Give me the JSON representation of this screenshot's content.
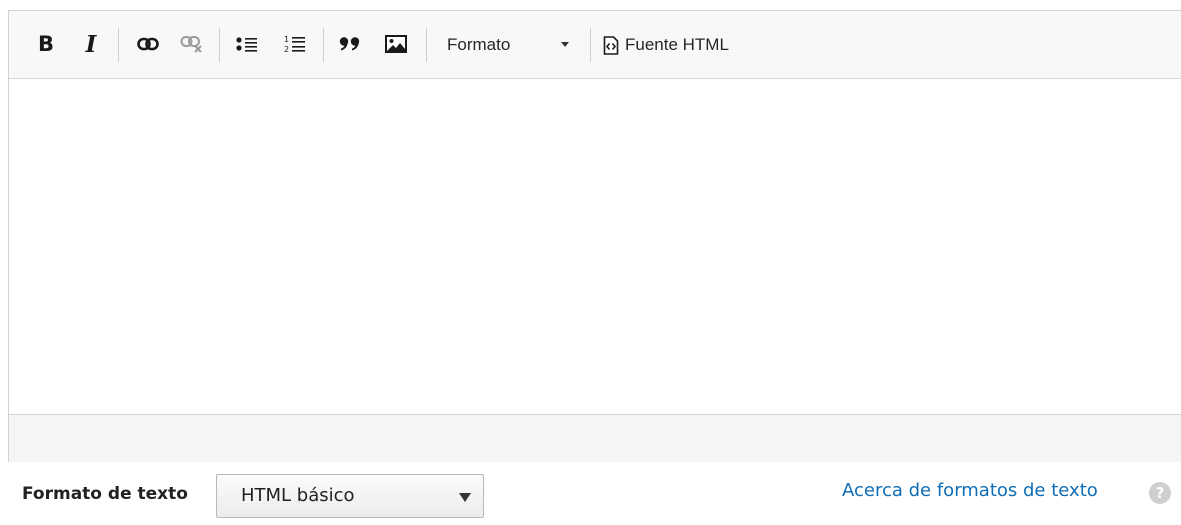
{
  "toolbar": {
    "bold_label": "B",
    "italic_label": "I",
    "link_icon": "link-icon",
    "unlink_icon": "unlink-icon",
    "bulleted_list_icon": "bulleted-list-icon",
    "numbered_list_icon": "numbered-list-icon",
    "blockquote_icon": "blockquote-icon",
    "image_icon": "image-icon",
    "format_select_label": "Formato",
    "source_label": "Fuente HTML"
  },
  "text_format": {
    "label": "Formato de texto",
    "selected": "HTML básico",
    "about_link": "Acerca de formatos de texto",
    "help_icon_glyph": "?"
  },
  "colors": {
    "link": "#0f6db5",
    "toolbar_bg": "#f8f8f8",
    "status_bg": "#f5f5f5"
  }
}
